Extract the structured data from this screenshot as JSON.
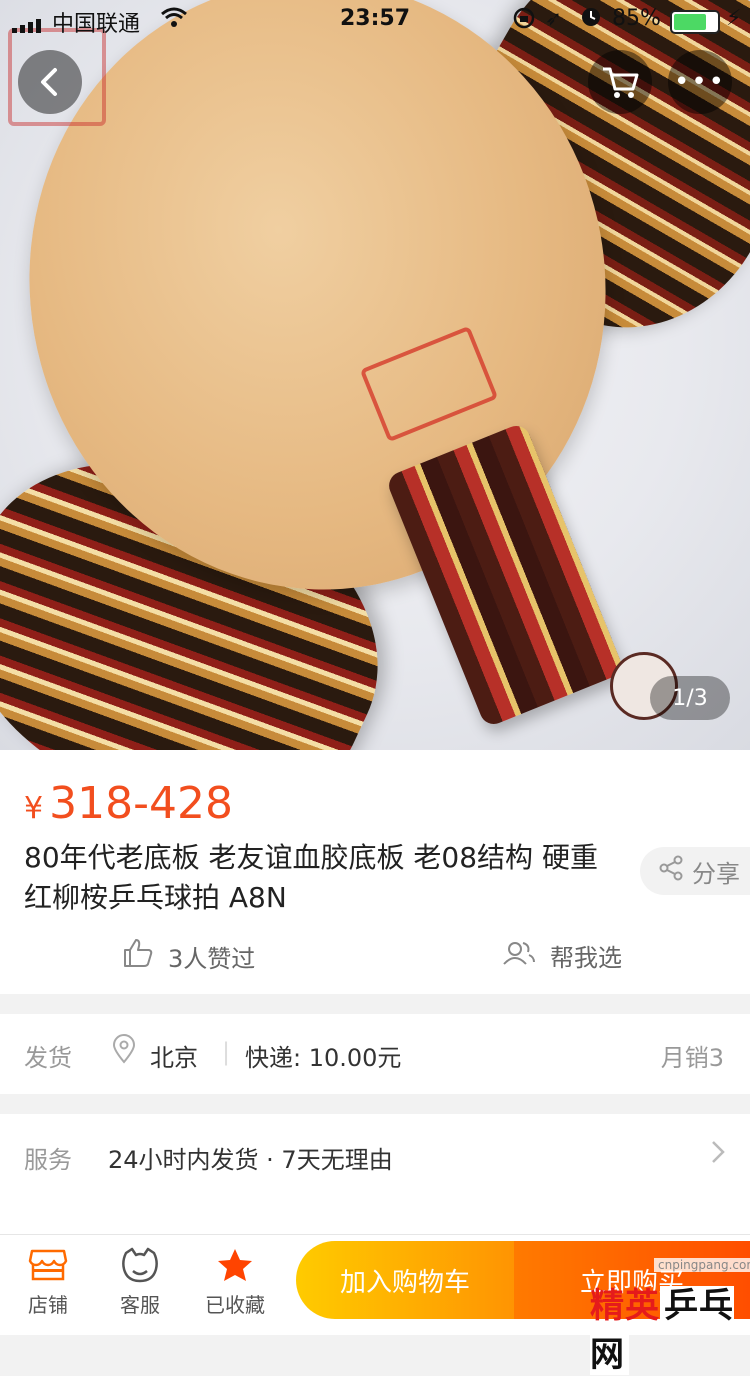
{
  "status_bar": {
    "carrier": "中国联通",
    "time": "23:57",
    "battery_pct": "85%",
    "battery_level": 0.85
  },
  "gallery": {
    "pager": "1/3"
  },
  "product": {
    "currency": "¥",
    "price": "318-428",
    "title": "80年代老底板 老友谊血胶底板 老08结构 硬重 红柳桉乒乓球拍 A8N",
    "share_label": "分享",
    "likes_label": "3人赞过",
    "help_label": "帮我选"
  },
  "shipping": {
    "label": "发货",
    "location": "北京",
    "fee": "快递: 10.00元",
    "monthly_sales": "月销3"
  },
  "service": {
    "label": "服务",
    "text": "24小时内发货 · 7天无理由"
  },
  "bottom_bar": {
    "shop_label": "店铺",
    "cs_label": "客服",
    "fav_label": "已收藏",
    "add_cart_label": "加入购物车",
    "buy_now_label": "立即购买"
  },
  "watermark": {
    "domain": "cnpingpang.com",
    "brand_main": "精英",
    "brand_alt": "乒乓网"
  },
  "colors": {
    "price": "#f24e1e",
    "accent_orange": "#ff6a00",
    "add_cart": "#ffb300",
    "buy_now": "#ff5000"
  }
}
